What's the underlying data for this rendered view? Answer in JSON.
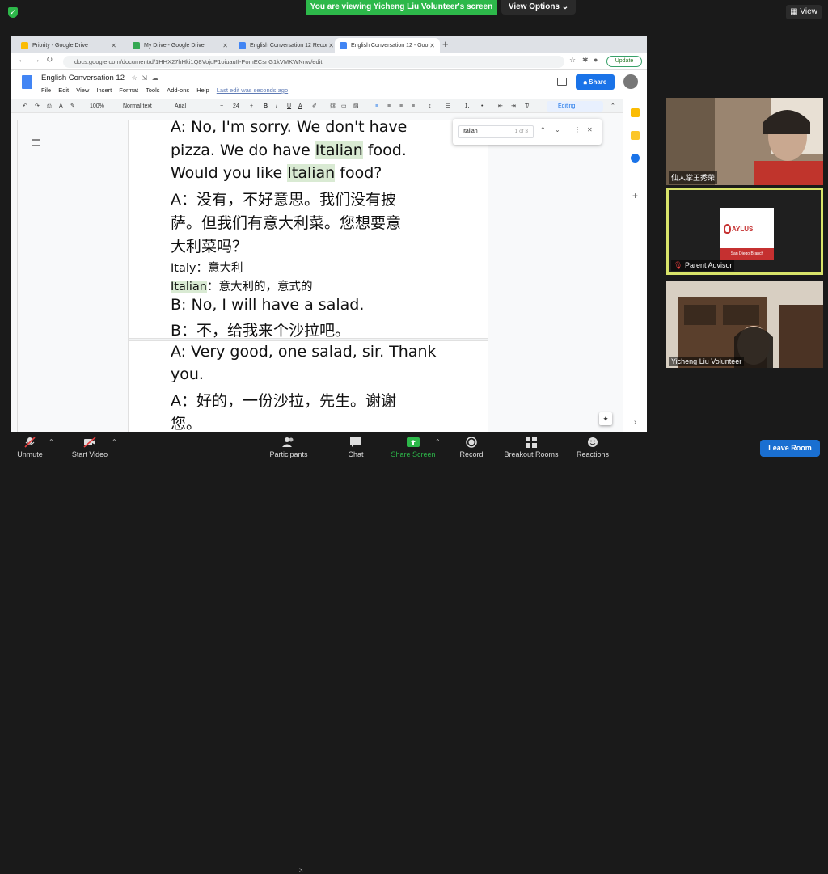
{
  "zoom": {
    "banner": "You are viewing Yicheng Liu Volunteer's screen",
    "view_options": "View Options",
    "view_button": "View",
    "participants_count": "3",
    "buttons": {
      "unmute": "Unmute",
      "start_video": "Start Video",
      "participants": "Participants",
      "chat": "Chat",
      "share_screen": "Share Screen",
      "record": "Record",
      "breakout_rooms": "Breakout Rooms",
      "reactions": "Reactions",
      "leave_room": "Leave Room"
    },
    "participants": [
      {
        "name": "仙人掌王秀荣"
      },
      {
        "name": "Parent Advisor"
      },
      {
        "name": "Yicheng Liu Volunteer"
      }
    ],
    "ayl_card": {
      "title": "AYLUS",
      "branch": "San Diego Branch"
    },
    "accent_green": "#2db84a",
    "leave_blue": "#1a6fd1"
  },
  "browser": {
    "tabs": [
      {
        "label": "Priority - Google Drive"
      },
      {
        "label": "My Drive - Google Drive"
      },
      {
        "label": "English Conversation 12 Recor"
      },
      {
        "label": "English Conversation 12 - Goo"
      }
    ],
    "url": "docs.google.com/document/d/1HHX27hHki1Q8VojuP1oiuauIf-PomECsnG1kVMKWNnw/edit",
    "update_label": "Update"
  },
  "docs": {
    "title": "English Conversation 12",
    "menus": [
      "File",
      "Edit",
      "View",
      "Insert",
      "Format",
      "Tools",
      "Add-ons",
      "Help"
    ],
    "last_edit": "Last edit was seconds ago",
    "share_label": "Share",
    "toolbar": {
      "zoom": "100%",
      "style": "Normal text",
      "font": "Arial",
      "font_size": "24",
      "mode": "Editing"
    },
    "find": {
      "query": "Italian",
      "count": "1 of 3"
    },
    "lines": {
      "l1": "A: No, I'm sorry. We don't have",
      "l2a": "pizza. We do have ",
      "l2b": "Italian",
      "l2c": " food.",
      "l3a": "Would you like ",
      "l3b": "Italian",
      "l3c": " food?",
      "l4": "A：没有，不好意思。我们没有披",
      "l5": "萨。但我们有意大利菜。您想要意",
      "l6": "大利菜吗？",
      "l7": "Italy：意大利",
      "l8a": "Italian",
      "l8b": "：意大利的，意式的",
      "l9": "B: No, I will have a salad.",
      "l10": "B：不，给我来个沙拉吧。",
      "l11": "A: Very good, one salad, sir. Thank",
      "l12": "you.",
      "l13": "A：好的，一份沙拉，先生。谢谢",
      "l14": "您。"
    },
    "highlight_color": "#d9ead3"
  }
}
